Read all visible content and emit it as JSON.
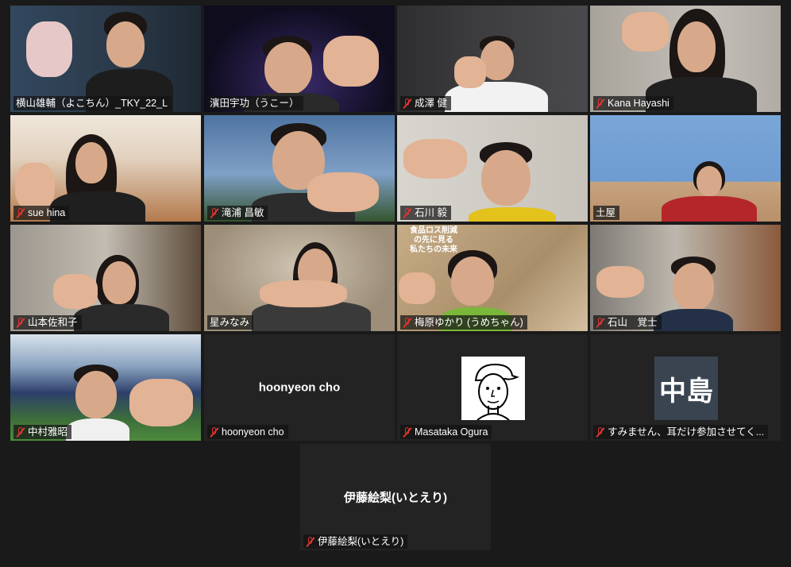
{
  "participants": [
    {
      "name": "横山雄輔（よこちん）_TKY_22_L",
      "muted": false,
      "bg": "#2b3a4a",
      "body": "#1d1d1d"
    },
    {
      "name": "濱田宇功（うこー）",
      "muted": false,
      "bg": "#0f0c1e",
      "body": "#2a2a2a"
    },
    {
      "name": "成澤 健",
      "muted": true,
      "bg": "#3c3b3d",
      "body": "#f2f2f2"
    },
    {
      "name": "Kana Hayashi",
      "muted": true,
      "bg": "#b9b4ae",
      "body": "#202020"
    },
    {
      "name": "sue hina",
      "muted": true,
      "bg": "#c89a72",
      "body": "#1f1f1f"
    },
    {
      "name": "滝浦 昌敏",
      "muted": true,
      "bg": "#5478a6",
      "body": "#2c2c2c"
    },
    {
      "name": "石川 毅",
      "muted": true,
      "bg": "#cfcbc3",
      "body": "#e3c21b"
    },
    {
      "name": "土屋",
      "muted": false,
      "bg": "#6e9cd1",
      "body": "#b5262b"
    },
    {
      "name": "山本佐和子",
      "muted": true,
      "bg": "#8a857c",
      "body": "#2a2a2a"
    },
    {
      "name": "星みなみ",
      "muted": false,
      "bg": "#a69a88",
      "body": "#3a3a3a",
      "active": true
    },
    {
      "name": "梅原ゆかり (うめちゃん)",
      "muted": true,
      "bg": "#b89c7a",
      "body": "#7ab73a",
      "poster": "食品ロス削減\nの先に見る\n私たちの未来"
    },
    {
      "name": "石山　覚士",
      "muted": true,
      "bg": "#8b7a68",
      "body": "#233048"
    },
    {
      "name": "中村雅昭",
      "muted": true,
      "bg": "#3d6e3a",
      "body": "#f0f0f0"
    },
    {
      "name": "hoonyeon cho",
      "muted": true,
      "display": "hoonyeon cho"
    },
    {
      "name": "Masataka Ogura",
      "muted": true,
      "cartoon": true
    },
    {
      "name": "すみません、耳だけ参加させてく...",
      "muted": true,
      "avatar_text": "中島"
    },
    {
      "name": "伊藤絵梨(いとえり)",
      "muted": true,
      "display": "伊藤絵梨(いとえり)"
    }
  ]
}
